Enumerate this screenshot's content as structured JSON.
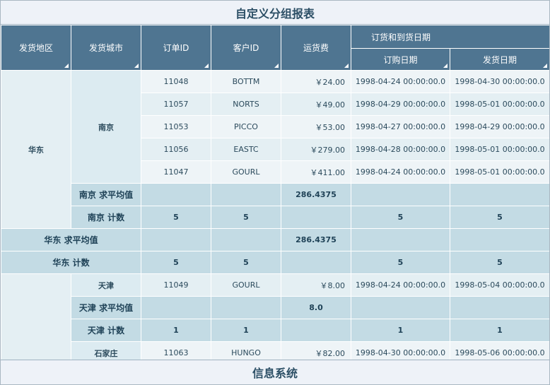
{
  "title": "自定义分组报表",
  "footer": "信息系统",
  "headers": {
    "region": "发货地区",
    "city": "发货城市",
    "order_id": "订单ID",
    "customer_id": "客户ID",
    "freight": "运货费",
    "date_group": "订货和到货日期",
    "order_date": "订购日期",
    "ship_date": "发货日期"
  },
  "regions": [
    {
      "name": "华东",
      "cities": [
        {
          "name": "南京",
          "rows": [
            {
              "order_id": "11048",
              "customer_id": "BOTTM",
              "freight": "￥24.00",
              "order_date": "1998-04-24 00:00:00.0",
              "ship_date": "1998-04-30 00:00:00.0"
            },
            {
              "order_id": "11057",
              "customer_id": "NORTS",
              "freight": "￥49.00",
              "order_date": "1998-04-29 00:00:00.0",
              "ship_date": "1998-05-01 00:00:00.0"
            },
            {
              "order_id": "11053",
              "customer_id": "PICCO",
              "freight": "￥53.00",
              "order_date": "1998-04-27 00:00:00.0",
              "ship_date": "1998-04-29 00:00:00.0"
            },
            {
              "order_id": "11056",
              "customer_id": "EASTC",
              "freight": "￥279.00",
              "order_date": "1998-04-28 00:00:00.0",
              "ship_date": "1998-05-01 00:00:00.0"
            },
            {
              "order_id": "11047",
              "customer_id": "GOURL",
              "freight": "￥411.00",
              "order_date": "1998-04-24 00:00:00.0",
              "ship_date": "1998-05-01 00:00:00.0"
            }
          ],
          "avg_label": "南京 求平均值",
          "avg_freight": "286.4375",
          "count_label": "南京 计数",
          "counts": {
            "order_id": "5",
            "customer_id": "5",
            "order_date": "5",
            "ship_date": "5"
          }
        }
      ],
      "avg_label": "华东 求平均值",
      "avg_freight": "286.4375",
      "count_label": "华东 计数",
      "counts": {
        "order_id": "5",
        "customer_id": "5",
        "order_date": "5",
        "ship_date": "5"
      }
    },
    {
      "cities": [
        {
          "name": "天津",
          "rows": [
            {
              "order_id": "11049",
              "customer_id": "GOURL",
              "freight": "￥8.00",
              "order_date": "1998-04-24 00:00:00.0",
              "ship_date": "1998-05-04 00:00:00.0"
            }
          ],
          "avg_label": "天津 求平均值",
          "avg_freight": "8.0",
          "count_label": "天津 计数",
          "counts": {
            "order_id": "1",
            "customer_id": "1",
            "order_date": "1",
            "ship_date": "1"
          }
        },
        {
          "name": "石家庄",
          "rows": [
            {
              "order_id": "11063",
              "customer_id": "HUNGO",
              "freight": "￥82.00",
              "order_date": "1998-04-30 00:00:00.0",
              "ship_date": "1998-05-06 00:00:00.0"
            }
          ]
        }
      ]
    }
  ]
}
